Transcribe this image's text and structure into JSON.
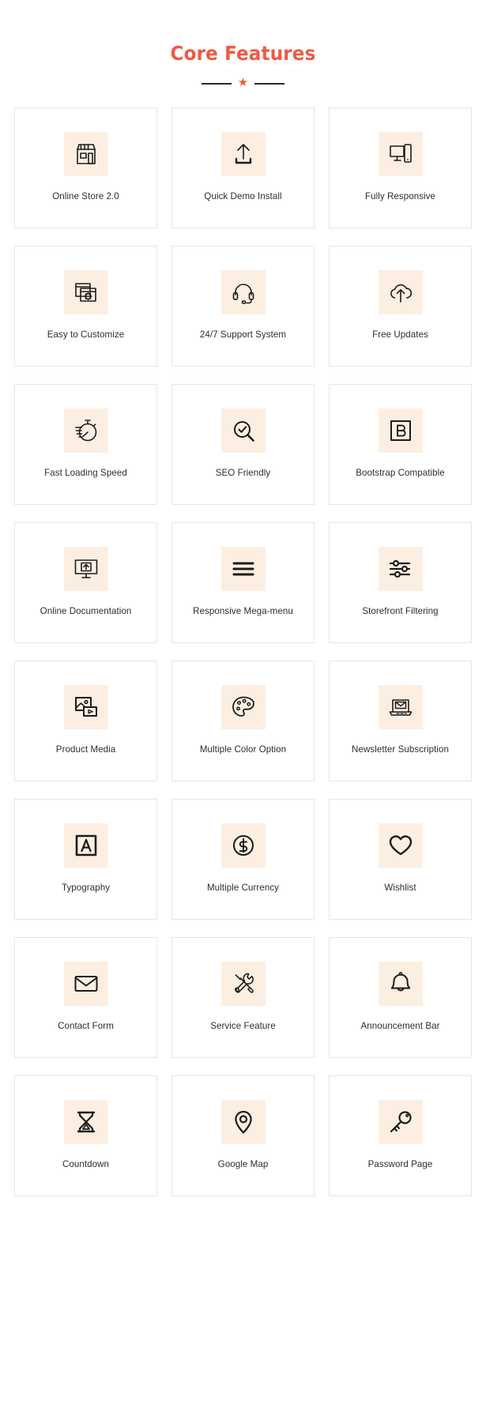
{
  "header": {
    "title": "Core Features",
    "divider_star": "★",
    "title_color": "#ec5b43"
  },
  "theme": {
    "accent": "#ec5b43",
    "icon_bg": "#fcefe2",
    "card_border": "#e6e6e6",
    "label_color": "#2e2e2e",
    "page_bg": "#ffffff"
  },
  "features": [
    {
      "label": "Online Store 2.0",
      "icon": "storefront-icon"
    },
    {
      "label": "Quick Demo Install",
      "icon": "upload-tray-icon"
    },
    {
      "label": "Fully Responsive",
      "icon": "desktop-mobile-icon"
    },
    {
      "label": "Easy to Customize",
      "icon": "browser-settings-icon"
    },
    {
      "label": "24/7 Support System",
      "icon": "headset-icon"
    },
    {
      "label": "Free Updates",
      "icon": "cloud-upload-icon"
    },
    {
      "label": "Fast Loading Speed",
      "icon": "stopwatch-icon"
    },
    {
      "label": "SEO Friendly",
      "icon": "magnifier-check-icon"
    },
    {
      "label": "Bootstrap Compatible",
      "icon": "bootstrap-b-icon"
    },
    {
      "label": "Online Documentation",
      "icon": "monitor-upload-icon"
    },
    {
      "label": "Responsive Mega-menu",
      "icon": "hamburger-menu-icon"
    },
    {
      "label": "Storefront Filtering",
      "icon": "sliders-filter-icon"
    },
    {
      "label": "Product Media",
      "icon": "image-video-icon"
    },
    {
      "label": "Multiple Color Option",
      "icon": "palette-icon"
    },
    {
      "label": "Newsletter Subscription",
      "icon": "laptop-mail-icon"
    },
    {
      "label": "Typography",
      "icon": "letter-a-box-icon"
    },
    {
      "label": "Multiple Currency",
      "icon": "dollar-circle-icon"
    },
    {
      "label": "Wishlist",
      "icon": "heart-icon"
    },
    {
      "label": "Contact Form",
      "icon": "envelope-icon"
    },
    {
      "label": "Service Feature",
      "icon": "wrench-screwdriver-icon"
    },
    {
      "label": "Announcement Bar",
      "icon": "bell-icon"
    },
    {
      "label": "Countdown",
      "icon": "hourglass-icon"
    },
    {
      "label": "Google Map",
      "icon": "map-pin-icon"
    },
    {
      "label": "Password Page",
      "icon": "key-icon"
    }
  ]
}
